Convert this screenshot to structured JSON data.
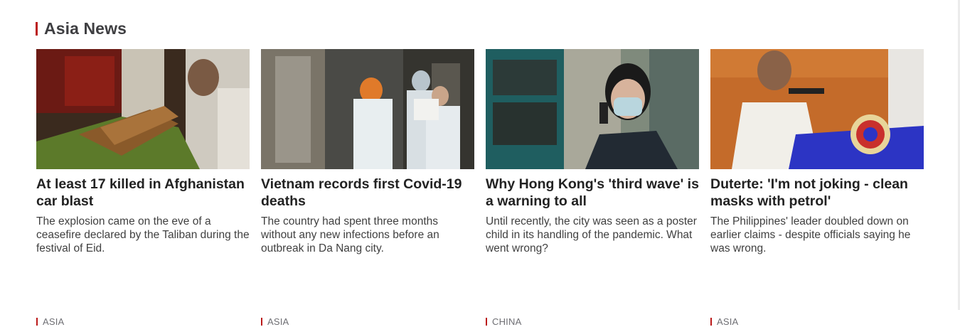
{
  "section": {
    "title": "Asia News"
  },
  "colors": {
    "accent": "#bb1919",
    "headline": "#222222",
    "summary": "#404040",
    "tag": "#6e6e73"
  },
  "stories": [
    {
      "image": "afghanistan-car-blast-photo",
      "headline": "At least 17 killed in Afghanistan car blast",
      "summary": "The explosion came on the eve of a ceasefire declared by the Taliban during the festival of Eid.",
      "tag": "ASIA"
    },
    {
      "image": "vietnam-medical-workers-photo",
      "headline": "Vietnam records first Covid-19 deaths",
      "summary": "The country had spent three months without any new infections before an outbreak in Da Nang city.",
      "tag": "ASIA"
    },
    {
      "image": "hong-kong-woman-mask-phone-photo",
      "headline": "Why Hong Kong's 'third wave' is a warning to all",
      "summary": "Until recently, the city was seen as a poster child in its handling of the pandemic. What went wrong?",
      "tag": "CHINA"
    },
    {
      "image": "duterte-podium-photo",
      "headline": "Duterte: 'I'm not joking - clean masks with petrol'",
      "summary": "The Philippines' leader doubled down on earlier claims - despite officials saying he was wrong.",
      "tag": "ASIA"
    }
  ]
}
